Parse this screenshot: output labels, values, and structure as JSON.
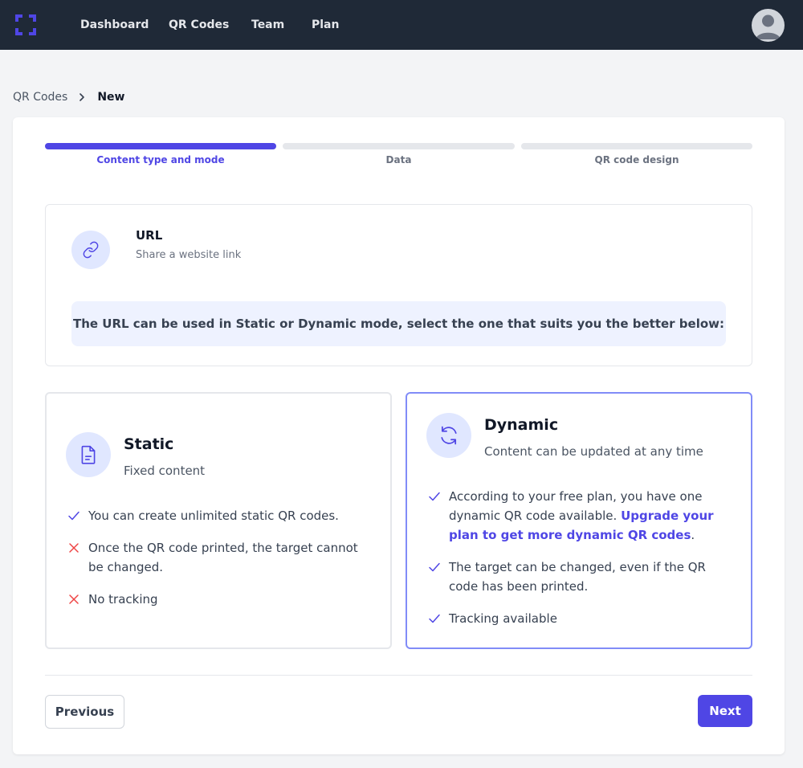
{
  "nav": {
    "items": [
      {
        "label": "Dashboard"
      },
      {
        "label": "QR Codes"
      },
      {
        "label": "Team"
      },
      {
        "label": "Plan"
      }
    ]
  },
  "breadcrumb": {
    "parent": "QR Codes",
    "current": "New"
  },
  "steps": [
    {
      "label": "Content type and mode",
      "active": true
    },
    {
      "label": "Data",
      "active": false
    },
    {
      "label": "QR code design",
      "active": false
    }
  ],
  "content_type": {
    "icon": "link-icon",
    "title": "URL",
    "description": "Share a website link",
    "banner": "The URL can be used in Static or Dynamic mode, select the one that suits you the better below:"
  },
  "modes": {
    "static": {
      "icon": "document-icon",
      "title": "Static",
      "subtitle": "Fixed content",
      "features": [
        {
          "text": "You can create unlimited static QR codes.",
          "ok": true
        },
        {
          "text": "Once the QR code printed, the target cannot be changed.",
          "ok": false
        },
        {
          "text": "No tracking",
          "ok": false
        }
      ]
    },
    "dynamic": {
      "icon": "refresh-icon",
      "title": "Dynamic",
      "subtitle": "Content can be updated at any time",
      "selected": true,
      "features": [
        {
          "text": "According to your free plan, you have one dynamic QR code available.",
          "link": "Upgrade your plan to get more dynamic QR codes",
          "suffix": ".",
          "ok": true
        },
        {
          "text": "The target can be changed, even if the QR code has been printed.",
          "ok": true
        },
        {
          "text": "Tracking available",
          "ok": true
        }
      ]
    }
  },
  "actions": {
    "previous": "Previous",
    "next": "Next"
  },
  "colors": {
    "primary": "#4f46e5",
    "topbar": "#1f2937",
    "check": "#4f46e5",
    "cross": "#ef4444"
  }
}
